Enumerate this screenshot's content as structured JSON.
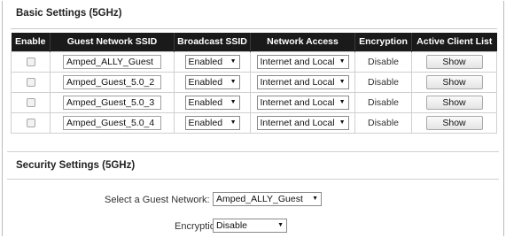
{
  "basic_settings": {
    "title": "Basic Settings (5GHz)",
    "columns": [
      "Enable",
      "Guest Network SSID",
      "Broadcast SSID",
      "Network Access",
      "Encryption",
      "Active Client List"
    ],
    "rows": [
      {
        "enabled": false,
        "ssid": "Amped_ALLY_Guest",
        "broadcast": "Enabled",
        "access": "Internet and Local",
        "encryption": "Disable",
        "action": "Show"
      },
      {
        "enabled": false,
        "ssid": "Amped_Guest_5.0_2",
        "broadcast": "Enabled",
        "access": "Internet and Local",
        "encryption": "Disable",
        "action": "Show"
      },
      {
        "enabled": false,
        "ssid": "Amped_Guest_5.0_3",
        "broadcast": "Enabled",
        "access": "Internet and Local",
        "encryption": "Disable",
        "action": "Show"
      },
      {
        "enabled": false,
        "ssid": "Amped_Guest_5.0_4",
        "broadcast": "Enabled",
        "access": "Internet and Local",
        "encryption": "Disable",
        "action": "Show"
      }
    ]
  },
  "security_settings": {
    "title": "Security Settings (5GHz)",
    "network_label": "Select a Guest Network:",
    "network_value": "Amped_ALLY_Guest",
    "encryption_label": "Encryption:",
    "encryption_value": "Disable"
  },
  "icons": {
    "dropdown": "dropdown-arrow-icon",
    "checkbox": "checkbox-icon"
  },
  "colors": {
    "header_bg": "#1a1a1a",
    "header_text": "#ffffff",
    "border": "#d0d0d0"
  }
}
